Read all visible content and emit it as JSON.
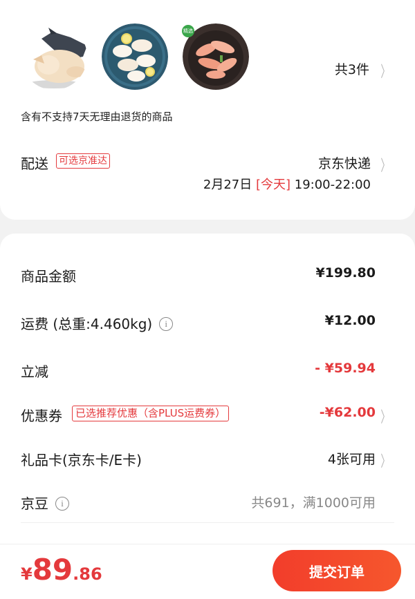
{
  "order": {
    "item_count": "共3件",
    "return_notice": "含有不支持7天无理由退货的商品",
    "products": [
      {
        "icon": "whole-chicken-image"
      },
      {
        "icon": "chicken-breast-plate-image"
      },
      {
        "icon": "chicken-strips-bowl-image"
      }
    ],
    "sticker": "精选"
  },
  "shipping": {
    "label": "配送",
    "badge": "可选京准达",
    "method": "京东快递",
    "date": "2月27日",
    "today": "[今天]",
    "time": "19:00-22:00"
  },
  "summary": {
    "goods_label": "商品金额",
    "goods_value": "¥199.80",
    "freight_label": "运费 (总重:4.460kg)",
    "freight_value": "¥12.00",
    "discount_label": "立减",
    "discount_value": "- ¥59.94",
    "coupon_label": "优惠券",
    "coupon_badge": "已选推荐优惠（含PLUS运费券）",
    "coupon_value": "-¥62.00",
    "giftcard_label": "礼品卡(京东卡/E卡)",
    "giftcard_value": "4张可用",
    "jingdou_label": "京豆",
    "jingdou_value": "共691，满1000可用",
    "info_icon": "i"
  },
  "footer": {
    "currency": "¥",
    "price_int": "89",
    "price_dec": ".86",
    "submit_label": "提交订单"
  },
  "colors": {
    "accent": "#e4393c",
    "button_start": "#f23d2b",
    "button_end": "#f6572d"
  }
}
